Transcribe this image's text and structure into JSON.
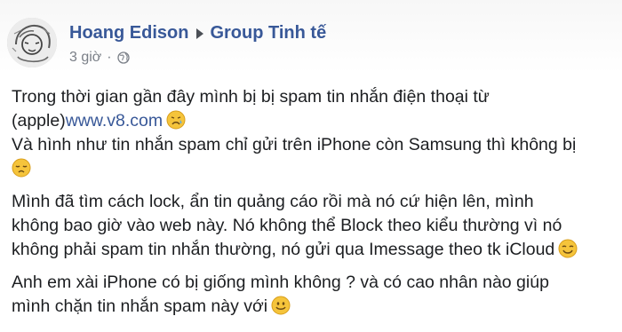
{
  "post": {
    "author": "Hoang Edison",
    "group": "Group Tinh tế",
    "time": "3 giờ",
    "separator": "·",
    "privacy_icon": "globe-icon",
    "lines": {
      "p1l1": "Trong thời gian gần đây mình bị bị spam tin nhắn điện thoại từ",
      "p1l2_prefix": "(apple)",
      "p1l2_link": "www.v8.com",
      "p1l3": "Và hình như tin nhắn spam chỉ gửi trên iPhone còn Samsung thì không bị",
      "p2l1": "Mình đã tìm cách lock, ẩn tin quảng cáo rồi mà nó cứ hiện lên, mình",
      "p2l2": "không bao giờ vào web này. Nó không thể Block theo kiểu thường vì nó",
      "p2l3": "không phải spam tin nhắn thường, nó gửi qua Imessage theo tk iCloud",
      "p3l1": "Anh em xài iPhone có bị giống mình không ? và có cao nhân nào giúp",
      "p3l2": "mình chặn tin nhắn spam này với"
    },
    "emojis": [
      "crying-face-emoji",
      "disappointed-face-emoji",
      "relieved-smile-emoji",
      "slightly-smiling-face-emoji"
    ]
  }
}
